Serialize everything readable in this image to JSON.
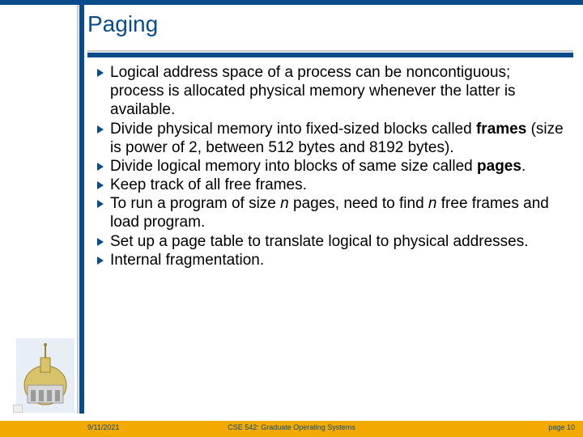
{
  "title": "Paging",
  "bullets": [
    "Logical address space of a process can be noncontiguous; process is allocated physical memory whenever the latter is available.",
    "Divide physical memory into fixed-sized blocks called <b>frames</b> (size is power of 2, between 512 bytes and 8192 bytes).",
    "Divide logical memory into blocks of same size called <b>pages</b>.",
    "Keep track of all free frames.",
    "To run a program of size <i>n</i> pages, need to find <i>n</i> free frames and load program.",
    "Set up a page table to translate logical to physical addresses.",
    "Internal fragmentation."
  ],
  "footer": {
    "left": "9/11/2021",
    "center": "CSE 542: Graduate Operating Systems",
    "right": "page 10"
  },
  "icons": {
    "bullet": "right-triangle",
    "logo": "capitol-dome"
  },
  "colors": {
    "brand": "#0a4b8c",
    "accent": "#f2a900",
    "rule": "#c9c9c9"
  }
}
